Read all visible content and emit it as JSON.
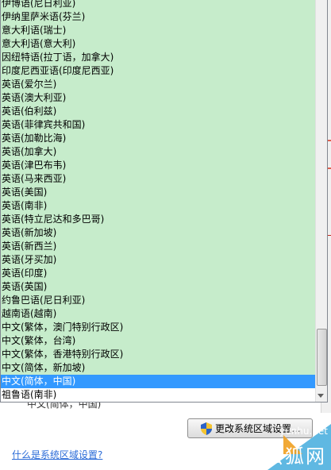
{
  "background": {
    "behind_text": "中文(简体，中国)",
    "change_button_label": "更改系统区域设置...",
    "help_link": "什么是系统区域设置?"
  },
  "locale_list": {
    "items": [
      "伊博语(尼日利亚)",
      "伊纳里萨米语(芬兰)",
      "意大利语(瑞士)",
      "意大利语(意大利)",
      "因纽特语(拉丁语，加拿大)",
      "印度尼西亚语(印度尼西亚)",
      "英语(爱尔兰)",
      "英语(澳大利亚)",
      "英语(伯利兹)",
      "英语(菲律宾共和国)",
      "英语(加勒比海)",
      "英语(加拿大)",
      "英语(津巴布韦)",
      "英语(马来西亚)",
      "英语(美国)",
      "英语(南非)",
      "英语(特立尼达和多巴哥)",
      "英语(新加坡)",
      "英语(新西兰)",
      "英语(牙买加)",
      "英语(印度)",
      "英语(英国)",
      "约鲁巴语(尼日利亚)",
      "越南语(越南)",
      "中文(繁体，澳门特别行政区)",
      "中文(繁体，台湾)",
      "中文(繁体，香港特别行政区)",
      "中文(简体，新加坡)",
      "中文(简体，中国)",
      "祖鲁语(南非)"
    ],
    "selected_index": 28
  },
  "watermark": {
    "url": "yunhu.net",
    "name": "云狐网"
  },
  "colors": {
    "list_highlight": "#c6eccb",
    "selection": "#3399ff",
    "red_line": "#c0281e"
  }
}
